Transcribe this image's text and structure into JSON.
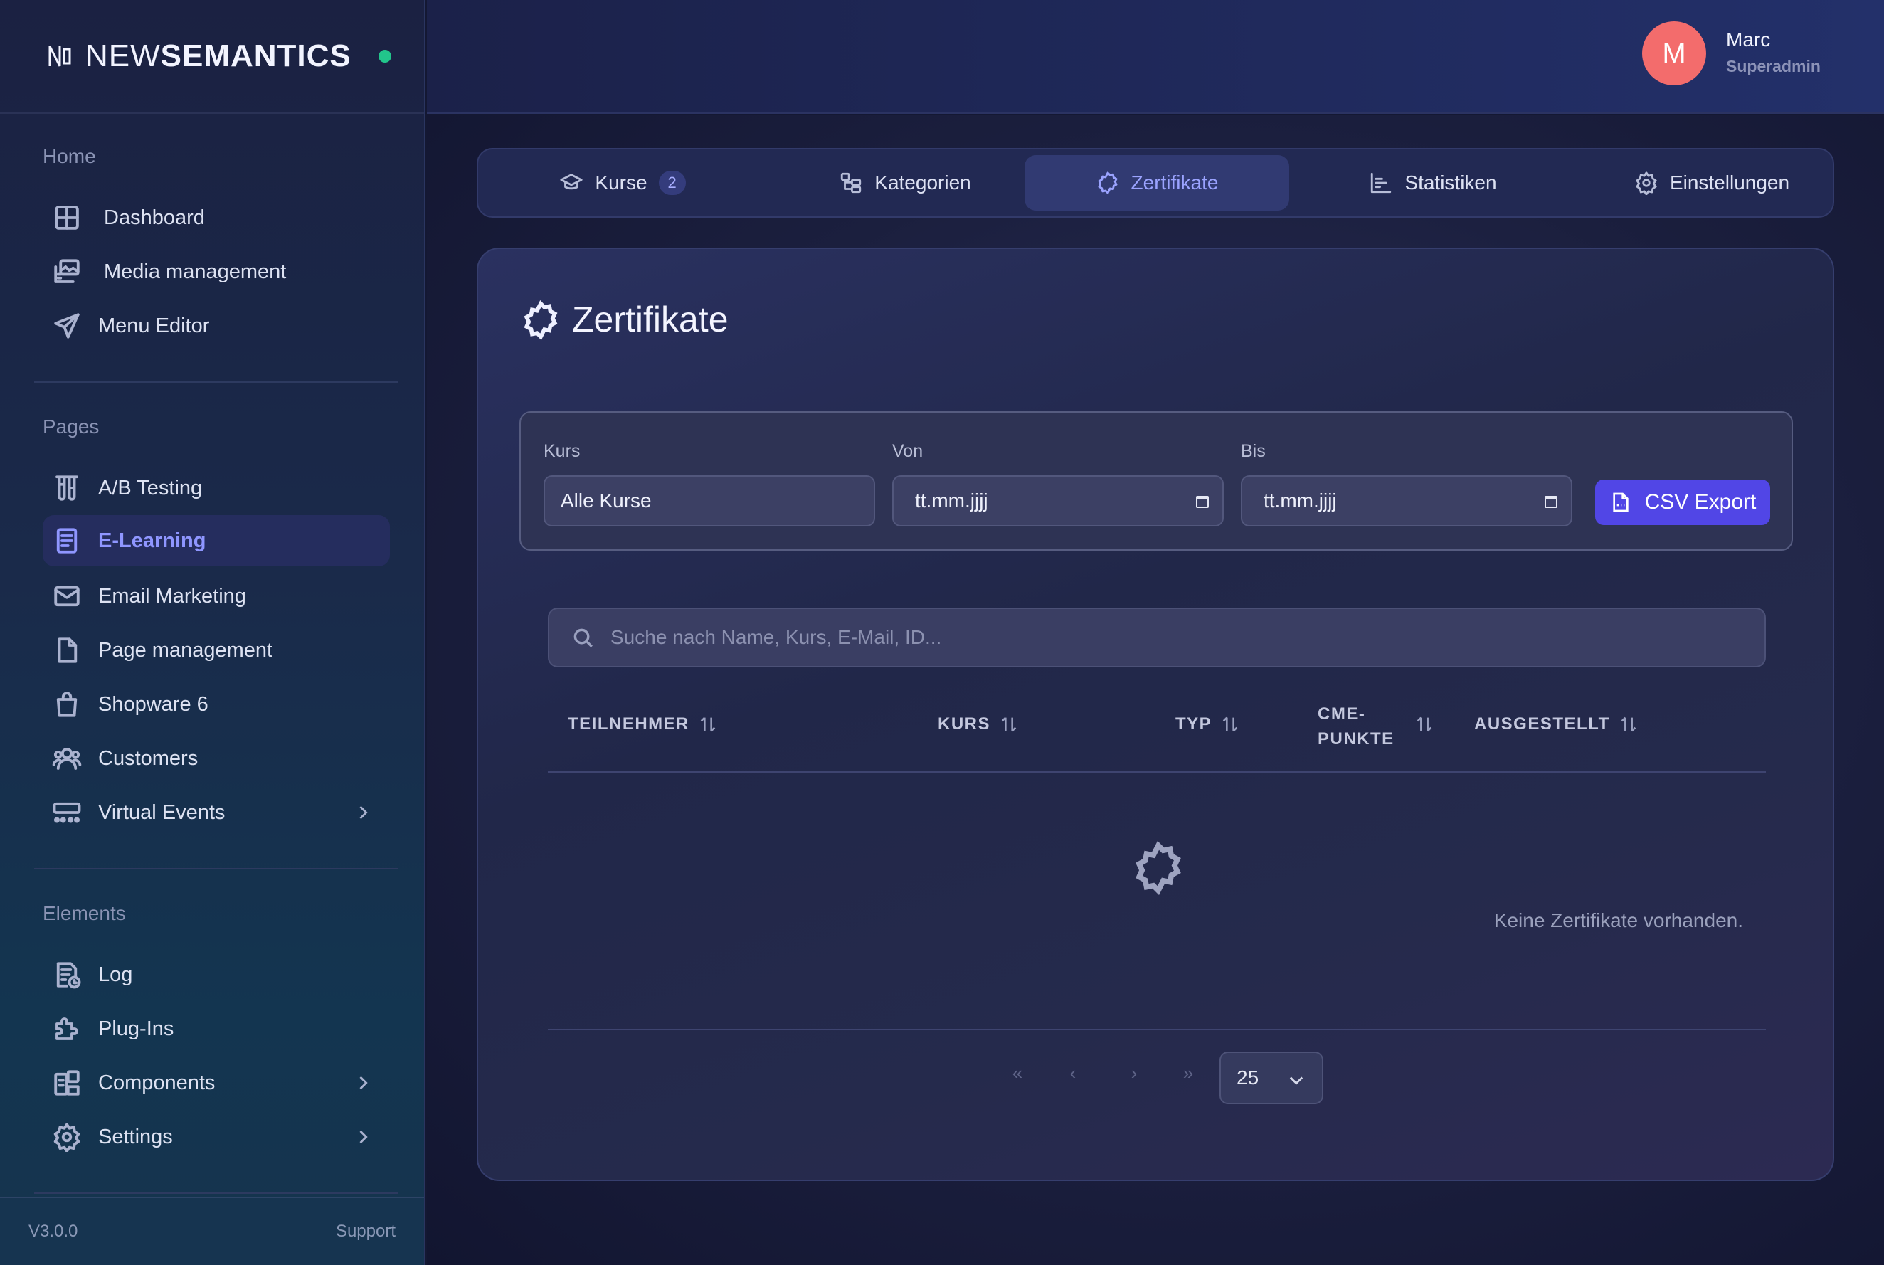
{
  "brand": {
    "name_light": "NEW",
    "name_bold": "SEMANTICS",
    "status_color": "#22c58b"
  },
  "user": {
    "initial": "M",
    "name": "Marc",
    "role": "Superadmin",
    "avatar_color": "#f36c6c"
  },
  "sidebar": {
    "sections": [
      {
        "title": "Home",
        "items": [
          {
            "label": "Dashboard",
            "icon": "grid-icon"
          },
          {
            "label": "Media management",
            "icon": "media-icon"
          },
          {
            "label": "Menu Editor",
            "icon": "send-icon"
          }
        ]
      },
      {
        "title": "Pages",
        "items": [
          {
            "label": "A/B Testing",
            "icon": "test-tubes-icon"
          },
          {
            "label": "E-Learning",
            "icon": "book-icon",
            "active": true
          },
          {
            "label": "Email Marketing",
            "icon": "mail-icon"
          },
          {
            "label": "Page management",
            "icon": "file-icon"
          },
          {
            "label": "Shopware 6",
            "icon": "shopping-bag-icon"
          },
          {
            "label": "Customers",
            "icon": "users-icon"
          },
          {
            "label": "Virtual Events",
            "icon": "events-icon",
            "expandable": true
          }
        ]
      },
      {
        "title": "Elements",
        "items": [
          {
            "label": "Log",
            "icon": "log-icon"
          },
          {
            "label": "Plug-Ins",
            "icon": "puzzle-icon"
          },
          {
            "label": "Components",
            "icon": "components-icon",
            "expandable": true
          },
          {
            "label": "Settings",
            "icon": "gear-icon",
            "expandable": true
          }
        ]
      }
    ],
    "footer": {
      "version": "V3.0.0",
      "support": "Support"
    }
  },
  "tabs": [
    {
      "label": "Kurse",
      "icon": "graduation-cap-icon",
      "badge": "2"
    },
    {
      "label": "Kategorien",
      "icon": "folder-tree-icon"
    },
    {
      "label": "Zertifikate",
      "icon": "badge-icon",
      "active": true
    },
    {
      "label": "Statistiken",
      "icon": "bar-chart-icon"
    },
    {
      "label": "Einstellungen",
      "icon": "gear-icon"
    }
  ],
  "card": {
    "title": "Zertifikate",
    "filter": {
      "course_label": "Kurs",
      "course_value": "Alle Kurse",
      "from_label": "Von",
      "from_value": "tt.mm.jjjj",
      "to_label": "Bis",
      "to_value": "tt.mm.jjjj",
      "export_label": "CSV Export"
    },
    "search_placeholder": "Suche nach Name, Kurs, E-Mail, ID...",
    "columns": [
      "TEILNEHMER",
      "KURS",
      "TYP",
      "CME-",
      "PUNKTE",
      "AUSGESTELLT"
    ],
    "empty_text": "Keine Zertifikate vorhanden.",
    "pagination": {
      "first": "«",
      "prev": "‹",
      "next": "›",
      "last": "»",
      "page_size": "25"
    },
    "accent_color": "#5146e6"
  }
}
